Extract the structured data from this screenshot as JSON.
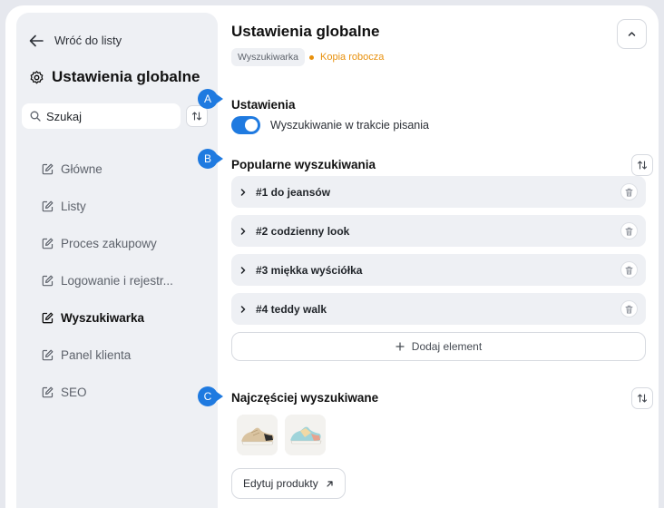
{
  "sidebar": {
    "back_label": "Wróć do listy",
    "title": "Ustawienia globalne",
    "search_value": "Szukaj",
    "nav": [
      {
        "label": "Główne",
        "active": false
      },
      {
        "label": "Listy",
        "active": false
      },
      {
        "label": "Proces zakupowy",
        "active": false
      },
      {
        "label": "Logowanie i rejestr...",
        "active": false
      },
      {
        "label": "Wyszukiwarka",
        "active": true
      },
      {
        "label": "Panel klienta",
        "active": false
      },
      {
        "label": "SEO",
        "active": false
      }
    ]
  },
  "main": {
    "title": "Ustawienia globalne",
    "breadcrumb_tag": "Wyszukiwarka",
    "status": "Kopia robocza",
    "settings_heading": "Ustawienia",
    "toggle_label": "Wyszukiwanie w trakcie pisania",
    "toggle_on": true,
    "popular_heading": "Popularne wyszukiwania",
    "popular_items": [
      "#1 do jeansów",
      "#2 codzienny look",
      "#3 miękka wyściółka",
      "#4 teddy walk"
    ],
    "add_label": "Dodaj element",
    "frequent_heading": "Najczęściej wyszukiwane",
    "edit_label": "Edytuj produkty"
  },
  "markers": [
    "A",
    "B",
    "C"
  ],
  "colors": {
    "accent": "#1f7ae0",
    "status": "#e8900c",
    "sidebar_bg": "#eef0f4"
  }
}
